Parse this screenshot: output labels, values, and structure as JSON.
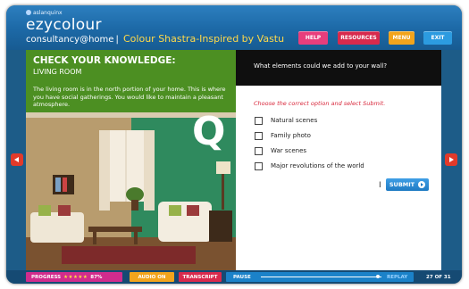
{
  "header": {
    "brand_small": "aslanquinx",
    "brand_name": "ezycolour",
    "brand_sub": "consultancy@home",
    "separator": "|",
    "course_title": "Colour Shastra-Inspired by Vastu",
    "buttons": {
      "help": "HELP",
      "resources": "RESOURCES",
      "menu": "MENU",
      "exit": "EXIT"
    }
  },
  "left_panel": {
    "title": "CHECK YOUR KNOWLEDGE:",
    "subtitle": "LIVING ROOM",
    "body": "The living room is in the north portion of your home. This is where you have social gatherings. You would like to maintain a pleasant atmosphere.",
    "q_letter": "Q"
  },
  "right_panel": {
    "question": "What elements could we add to your wall?",
    "instruction": "Choose the correct option and select Submit.",
    "options": [
      "Natural scenes",
      "Family photo",
      "War scenes",
      "Major revolutions of the world"
    ],
    "submit_label": "SUBMIT"
  },
  "footer": {
    "progress_label": "PROGRESS",
    "progress_stars": "★★★★★",
    "progress_percent": "87%",
    "audio_label": "AUDIO ON",
    "transcript_label": "TRANSCRIPT",
    "pause_label": "PAUSE",
    "playback_fraction": 0.97,
    "replay_label": "REPLAY",
    "page_count": "27 OF 31"
  },
  "colors": {
    "header_blue": "#1d6aa8",
    "left_green": "#4c8f22",
    "help": "#e83e7c",
    "resources": "#d82a4d",
    "menu": "#f2a41c",
    "exit": "#2c9be0"
  }
}
